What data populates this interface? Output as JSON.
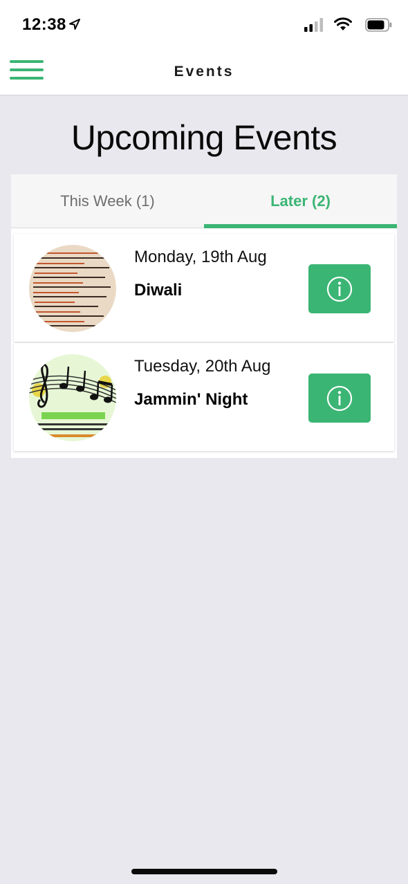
{
  "status_bar": {
    "time": "12:38",
    "icons": [
      "location-arrow-icon",
      "cellular-signal-icon",
      "wifi-icon",
      "battery-icon"
    ]
  },
  "nav": {
    "title": "Events",
    "menu_icon": "hamburger-menu-icon"
  },
  "page": {
    "title": "Upcoming Events"
  },
  "tabs": [
    {
      "label": "This Week (1)",
      "selected": false
    },
    {
      "label": "Later (2)",
      "selected": true
    }
  ],
  "events": [
    {
      "date": "Monday, 19th Aug",
      "name": "Diwali",
      "image": "menu-card-thumbnail",
      "action_icon": "info-icon"
    },
    {
      "date": "Tuesday, 20th Aug",
      "name": "Jammin' Night",
      "image": "music-notes-poster-thumbnail",
      "action_icon": "info-icon"
    }
  ],
  "colors": {
    "accent": "#3bb574",
    "background": "#e9e8ee",
    "panel": "#ffffff",
    "tab_bar": "#f6f6f6",
    "inactive_tab_text": "#6d6d6d"
  }
}
